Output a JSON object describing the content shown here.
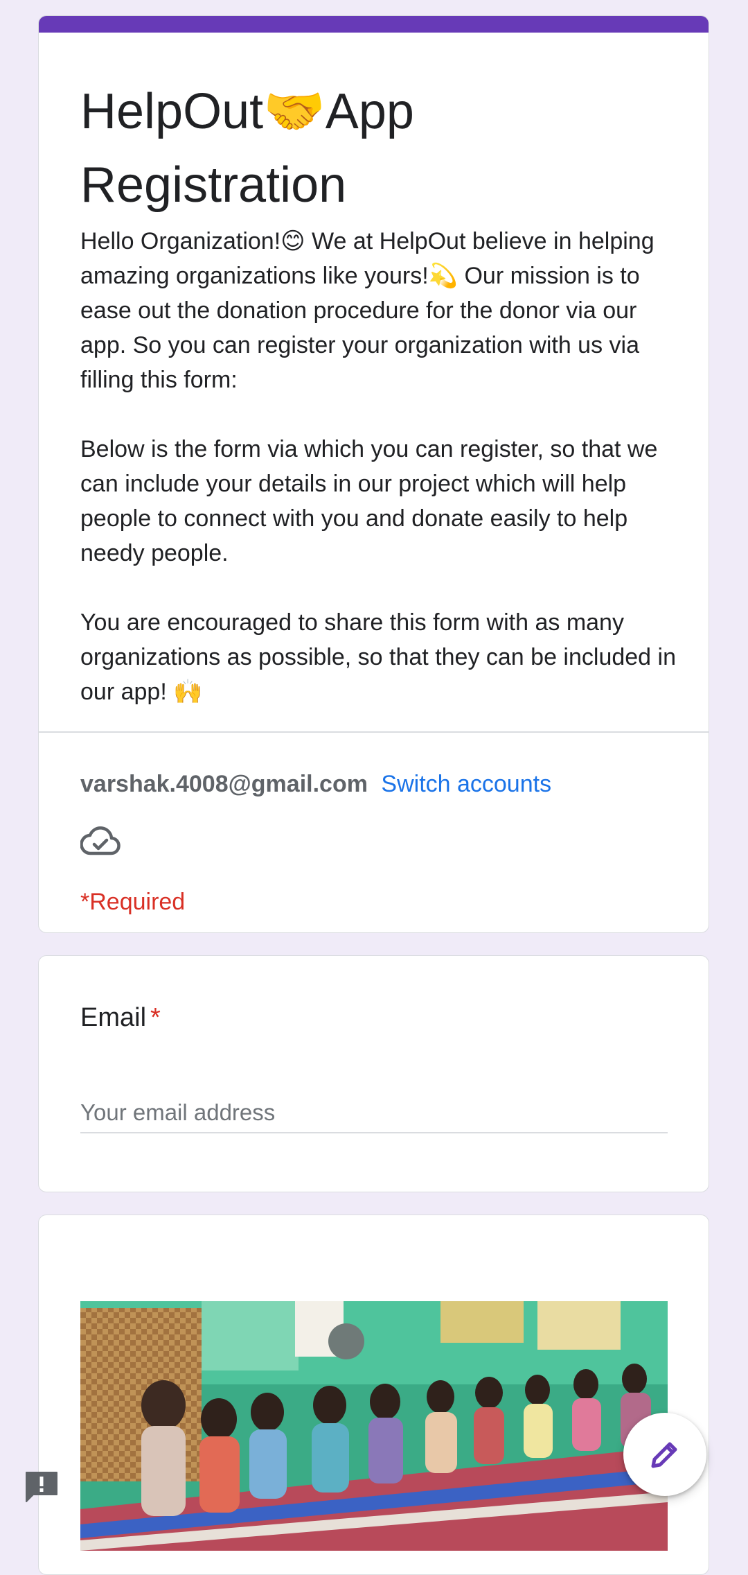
{
  "form": {
    "title_line1_before": "HelpOut",
    "title_emoji": "🤝",
    "title_line1_after": "App",
    "title_line2": "Registration",
    "description": [
      "Hello Organization!😊 We at HelpOut believe in helping amazing organizations like yours!💫 Our mission is to ease out the donation procedure for the donor via our app. So you can register your organization with us via filling this form:",
      "Below is the form via which you can register, so that we can include your details in our project which will help people to connect with you and donate easily to help needy people.",
      "You are encouraged to share this form with as many organizations as possible, so that they can be included in our app! 🙌"
    ],
    "account_email": "varshak.4008@gmail.com",
    "switch_accounts_label": "Switch accounts",
    "required_note": "*Required",
    "accent_color": "#673ab7",
    "background_color": "#f0ebf8"
  },
  "email_question": {
    "title": "Email",
    "required_marker": "*",
    "value": "",
    "placeholder": "Your email address"
  },
  "icons": {
    "saved": "cloud-check-icon",
    "feedback": "feedback-icon",
    "edit": "pencil-icon"
  }
}
